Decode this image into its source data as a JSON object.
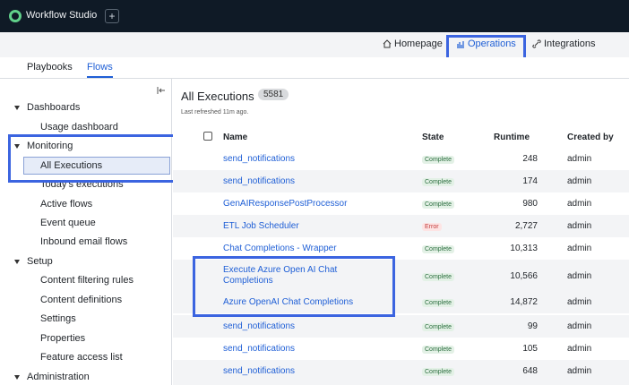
{
  "app": {
    "title": "Workflow Studio",
    "plus_label": "+"
  },
  "nav": {
    "homepage": "Homepage",
    "operations": "Operations",
    "integrations": "Integrations"
  },
  "subtabs": {
    "playbooks": "Playbooks",
    "flows": "Flows"
  },
  "sidebar": {
    "sections": [
      {
        "label": "Dashboards",
        "items": [
          "Usage dashboard"
        ]
      },
      {
        "label": "Monitoring",
        "items": [
          "All Executions",
          "Today's executions",
          "Active flows",
          "Event queue",
          "Inbound email flows"
        ]
      },
      {
        "label": "Setup",
        "items": [
          "Content filtering rules",
          "Content definitions",
          "Settings",
          "Properties",
          "Feature access list"
        ]
      },
      {
        "label": "Administration",
        "items": []
      }
    ]
  },
  "main": {
    "title": "All Executions",
    "count": "5581",
    "refreshed": "Last refreshed 11m ago.",
    "columns": {
      "name": "Name",
      "state": "State",
      "runtime": "Runtime",
      "created_by": "Created by"
    },
    "rows": [
      {
        "name": "send_notifications",
        "state": "Complete",
        "runtime": "248",
        "created_by": "admin"
      },
      {
        "name": "send_notifications",
        "state": "Complete",
        "runtime": "174",
        "created_by": "admin"
      },
      {
        "name": "GenAIResponsePostProcessor",
        "state": "Complete",
        "runtime": "980",
        "created_by": "admin"
      },
      {
        "name": "ETL Job Scheduler",
        "state": "Error",
        "runtime": "2,727",
        "created_by": "admin"
      },
      {
        "name": "Chat Completions - Wrapper",
        "state": "Complete",
        "runtime": "10,313",
        "created_by": "admin"
      },
      {
        "name": "Execute Azure Open AI Chat Completions",
        "state": "Complete",
        "runtime": "10,566",
        "created_by": "admin"
      },
      {
        "name": "Azure OpenAI Chat Completions",
        "state": "Complete",
        "runtime": "14,872",
        "created_by": "admin"
      },
      {
        "name": "send_notifications",
        "state": "Complete",
        "runtime": "99",
        "created_by": "admin"
      },
      {
        "name": "send_notifications",
        "state": "Complete",
        "runtime": "105",
        "created_by": "admin"
      },
      {
        "name": "send_notifications",
        "state": "Complete",
        "runtime": "648",
        "created_by": "admin"
      }
    ]
  },
  "colors": {
    "accent": "#1f5fd6",
    "highlight": "#3b64e0",
    "topbar": "#0f1a26"
  }
}
